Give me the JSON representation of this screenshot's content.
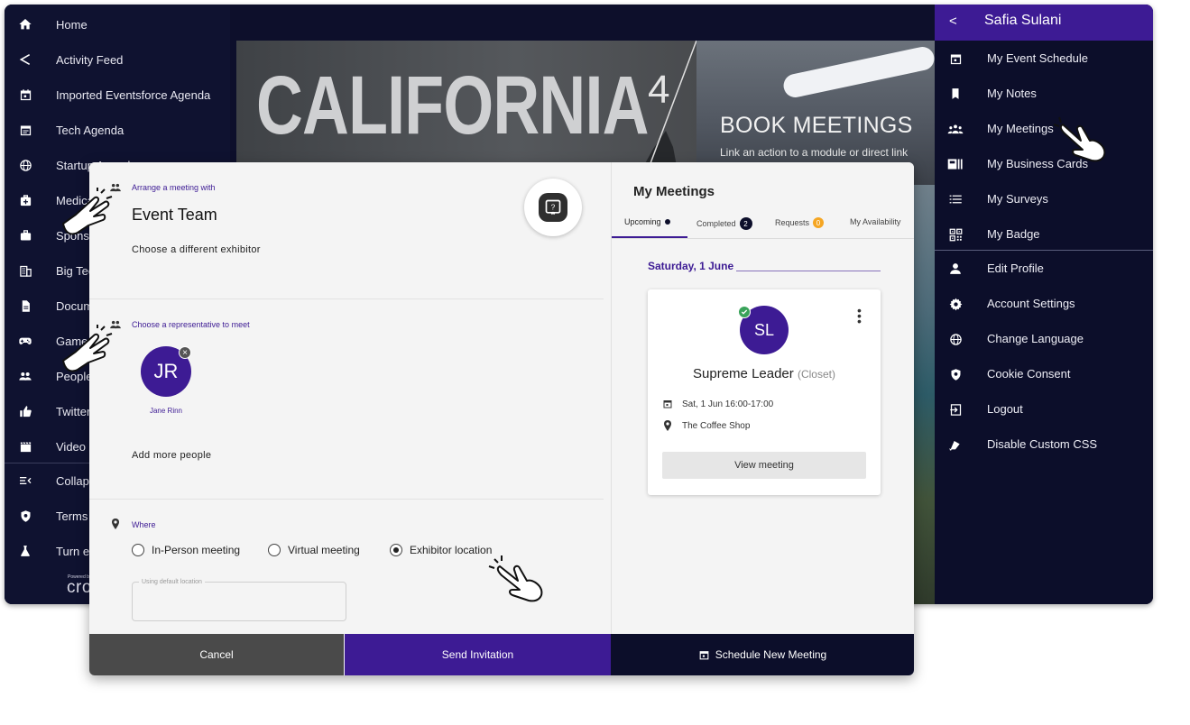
{
  "left_nav": {
    "items": [
      {
        "label": "Home",
        "icon": "home-icon"
      },
      {
        "label": "Activity Feed",
        "icon": "share-icon"
      },
      {
        "label": "Imported Eventsforce Agenda",
        "icon": "calendar-icon"
      },
      {
        "label": "Tech Agenda",
        "icon": "calendar-lines-icon"
      },
      {
        "label": "Startup Agenda",
        "icon": "globe-icon"
      },
      {
        "label": "Medical",
        "icon": "medical-bag-icon"
      },
      {
        "label": "Sponsors",
        "icon": "briefcase-icon"
      },
      {
        "label": "Big Tech",
        "icon": "building-icon"
      },
      {
        "label": "Documents",
        "icon": "document-icon"
      },
      {
        "label": "Games",
        "icon": "gamepad-icon"
      },
      {
        "label": "People",
        "icon": "people-icon"
      },
      {
        "label": "Twitter",
        "icon": "thumbs-up-icon"
      },
      {
        "label": "Video",
        "icon": "clapperboard-icon"
      },
      {
        "label": "Collapse",
        "icon": "collapse-menu-icon"
      },
      {
        "label": "Terms",
        "icon": "shield-icon"
      },
      {
        "label": "Turn e",
        "icon": "flask-icon"
      }
    ],
    "powered_by": "Powered by",
    "brand": "cro"
  },
  "banner": {
    "title": "CALIFORNIA",
    "superscript": "4",
    "cta_title": "BOOK MEETINGS",
    "cta_subtitle": "Link an action to a module or direct link"
  },
  "drawer": {
    "user_name": "Safia Sulani",
    "back_label": "<",
    "items": [
      {
        "label": "My Event Schedule",
        "icon": "calendar-icon"
      },
      {
        "label": "My Notes",
        "icon": "bookmark-icon"
      },
      {
        "label": "My Meetings",
        "icon": "group-icon"
      },
      {
        "label": "My Business Cards",
        "icon": "business-card-icon"
      },
      {
        "label": "My Surveys",
        "icon": "list-icon"
      },
      {
        "label": "My Badge",
        "icon": "qr-code-icon"
      },
      {
        "label": "Edit Profile",
        "icon": "person-icon"
      },
      {
        "label": "Account Settings",
        "icon": "gear-icon"
      },
      {
        "label": "Change Language",
        "icon": "globe-icon"
      },
      {
        "label": "Cookie Consent",
        "icon": "cookie-shield-icon"
      },
      {
        "label": "Logout",
        "icon": "logout-icon"
      },
      {
        "label": "Disable Custom CSS",
        "icon": "paint-icon"
      }
    ]
  },
  "dialog": {
    "arrange_label": "Arrange a meeting with",
    "exhibitor_name": "Event Team",
    "choose_exhibitor": "Choose a different exhibitor",
    "rep_label": "Choose a representative to meet",
    "rep": {
      "initials": "JR",
      "name": "Jane Rinn",
      "remove": "×"
    },
    "add_people": "Add more people",
    "where_label": "Where",
    "location_options": [
      {
        "label": "In-Person meeting",
        "selected": false
      },
      {
        "label": "Virtual meeting",
        "selected": false
      },
      {
        "label": "Exhibitor location",
        "selected": true
      }
    ],
    "location_field_label": "Using default location",
    "buttons": {
      "cancel": "Cancel",
      "send": "Send Invitation",
      "schedule": "Schedule New Meeting"
    }
  },
  "meetings_panel": {
    "title": "My Meetings",
    "tabs": [
      {
        "label": "Upcoming",
        "active": true
      },
      {
        "label": "Completed",
        "count": "2"
      },
      {
        "label": "Requests",
        "count": "0"
      },
      {
        "label": "My Availability"
      }
    ],
    "date_header": "Saturday, 1 June",
    "meeting": {
      "initials": "SL",
      "name": "Supreme Leader",
      "location_tag": "(Closet)",
      "time": "Sat, 1 Jun 16:00-17:00",
      "place": "The Coffee Shop",
      "view_button": "View meeting"
    }
  },
  "colors": {
    "primary_purple": "#3d1b94",
    "dark_navy": "#0c0e2a",
    "requests_badge": "#f5a623",
    "status_green": "#3aa35a"
  }
}
